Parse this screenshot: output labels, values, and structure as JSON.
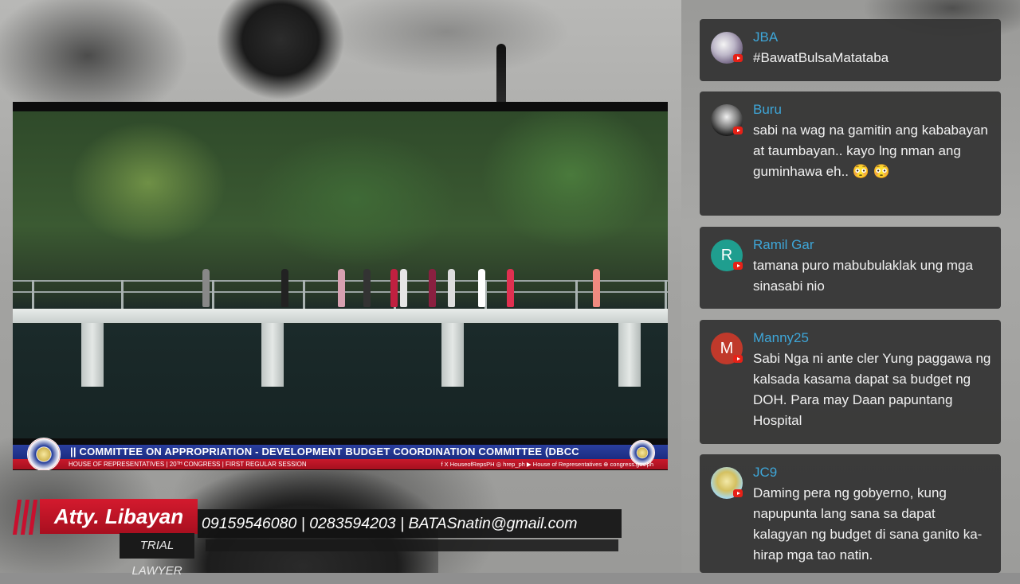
{
  "video": {
    "banner_title": "||   COMMITTEE ON APPROPRIATION - DEVELOPMENT BUDGET COORDINATION COMMITTEE  (DBCC",
    "banner_subtitle": "HOUSE OF REPRESENTATIVES  |  20ᵀᴴ CONGRESS  |  FIRST REGULAR SESSION",
    "banner_social": "f X HouseofRepsPH   ◎ hrep_ph   ▶ House of Representatives   ⊕ congress.gov.ph",
    "colors": {
      "banner_blue": "#1f3090",
      "banner_red": "#c8192b"
    }
  },
  "presenter": {
    "name": "Atty. Libayan",
    "role": "TRIAL LAWYER",
    "contact": "09159546080 | 0283594203 | BATASnatin@gmail.com",
    "accent_color": "#c8102e"
  },
  "chat": {
    "author_color": "#3ea6d8",
    "messages": [
      {
        "author": "JBA",
        "text": "#BawatBulsaMatataba",
        "avatar_icon": "profile-photo-icon"
      },
      {
        "author": "Buru",
        "text": "sabi na wag na gamitin ang kababayan at taumbayan.. kayo lng nman ang guminhawa eh.. 😳 😳",
        "avatar_icon": "profile-photo-icon"
      },
      {
        "author": "Ramil Gar",
        "text": "tamana puro mabubulaklak ung mga sinasabi nio",
        "avatar_letter": "R",
        "avatar_color": "#1f9e8f"
      },
      {
        "author": "Manny25",
        "text": "Sabi Nga ni ante cler Yung paggawa ng kalsada kasama dapat sa budget ng DOH. Para may Daan papuntang Hospital",
        "avatar_letter": "M",
        "avatar_color": "#c0392b"
      },
      {
        "author": "JC9",
        "text": "Daming pera ng gobyerno, kung napupunta lang sana sa dapat kalagyan ng budget di sana ganito ka-hirap mga tao natin.",
        "avatar_icon": "profile-photo-icon"
      }
    ]
  }
}
